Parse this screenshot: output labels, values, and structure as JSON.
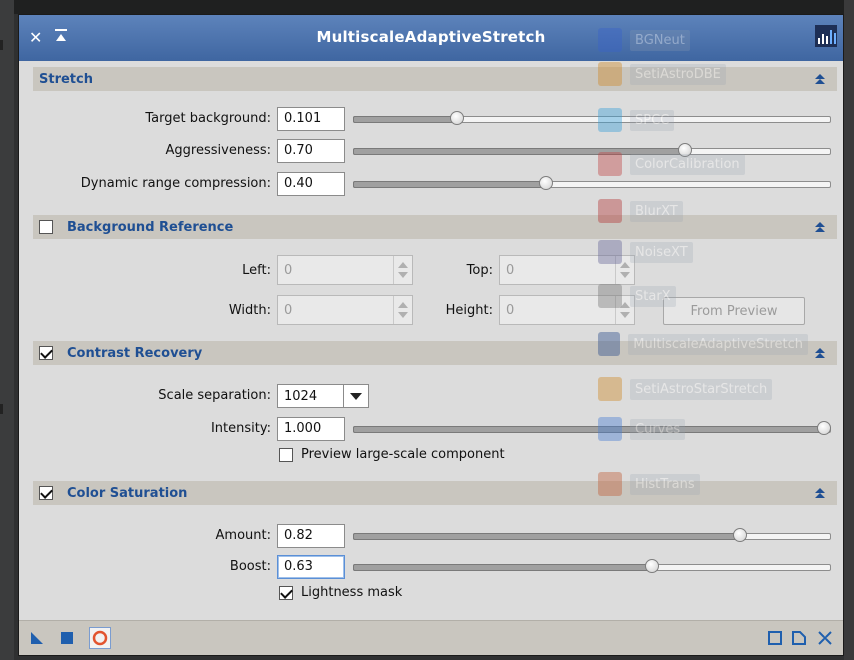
{
  "window": {
    "title": "MultiscaleAdaptiveStretch"
  },
  "stretch": {
    "title": "Stretch",
    "rows": [
      {
        "label": "Target background:",
        "value": "0.101",
        "fraction": 0.21
      },
      {
        "label": "Aggressiveness:",
        "value": "0.70",
        "fraction": 0.7
      },
      {
        "label": "Dynamic range compression:",
        "value": "0.40",
        "fraction": 0.4
      }
    ]
  },
  "background_reference": {
    "title": "Background Reference",
    "checked": false,
    "left_label": "Left:",
    "left_value": "0",
    "top_label": "Top:",
    "top_value": "0",
    "width_label": "Width:",
    "width_value": "0",
    "height_label": "Height:",
    "height_value": "0",
    "from_preview_label": "From Preview"
  },
  "contrast_recovery": {
    "title": "Contrast Recovery",
    "checked": true,
    "scale_label": "Scale separation:",
    "scale_value": "1024",
    "intensity_label": "Intensity:",
    "intensity_value": "1.000",
    "intensity_fraction": 1.0,
    "preview_label": "Preview large-scale component",
    "preview_checked": false
  },
  "color_saturation": {
    "title": "Color Saturation",
    "checked": true,
    "amount_label": "Amount:",
    "amount_value": "0.82",
    "amount_fraction": 0.82,
    "boost_label": "Boost:",
    "boost_value": "0.63",
    "boost_fraction": 0.63,
    "lightness_label": "Lightness mask",
    "lightness_checked": true
  },
  "ghost_icons": [
    {
      "label": "BGNeut",
      "color": "#3a63c9"
    },
    {
      "label": "SetiAstroDBE",
      "color": "#d08a2a"
    },
    {
      "label": "SPCC",
      "color": "#3aa0d8"
    },
    {
      "label": "ColorCalibration",
      "color": "#c04747"
    },
    {
      "label": "BlurXT",
      "color": "#b43a3a"
    },
    {
      "label": "NoiseXT",
      "color": "#6a6a9a"
    },
    {
      "label": "StarX",
      "color": "#7a7a7a"
    },
    {
      "label": "MultiscaleAdaptiveStretch",
      "color": "#2e4f8c"
    },
    {
      "label": "SetiAstroStarStretch",
      "color": "#d08a2a"
    },
    {
      "label": "Curves",
      "color": "#4a7fd4"
    },
    {
      "label": "HistTrans",
      "color": "#c0603a"
    }
  ],
  "icons": {
    "close": "close-icon",
    "shade": "shade-icon",
    "process": "process-icon",
    "collapse": "collapse-icon"
  },
  "colors": {
    "titlebar": "#4a71ac",
    "section_text": "#1f4f93",
    "section_bg": "#c9c6bf"
  }
}
